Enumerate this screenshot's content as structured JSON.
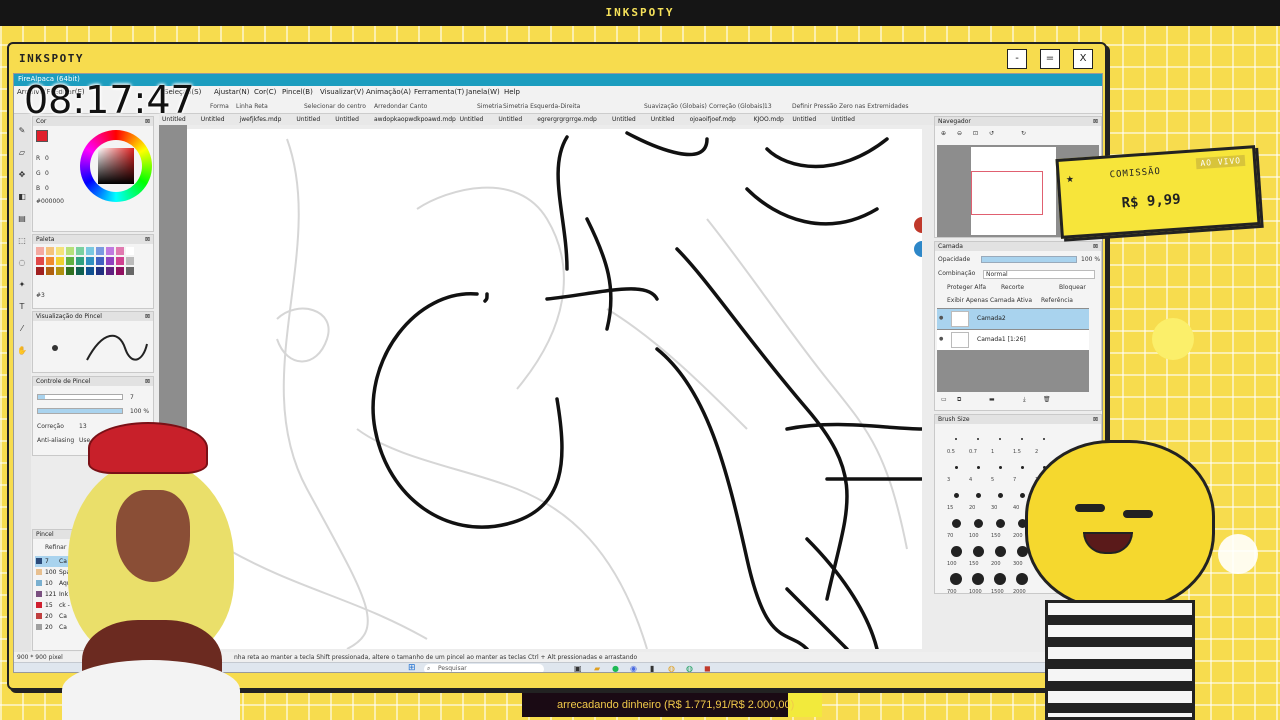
{
  "overlay": {
    "top_title": "INKSPOTY",
    "frame_title": "INKSPOTY",
    "frame_buttons": [
      "-",
      "=",
      "X"
    ],
    "clock": "08:17:47",
    "commission_label": "COMISSÃO",
    "commission_live": "AO VIVO",
    "commission_price": "R$  9,99",
    "goal_text": "arrecadando dinheiro (R$ 1.771,91/R$ 2.000,00)",
    "goal_progress": 0.886
  },
  "app": {
    "title": "FireAlpaca (64bit)",
    "menu": [
      "Arquivo(F)",
      "Editar(E)",
      "Seleção(S)",
      "Ajustar(N)",
      "Cor(C)",
      "Pincel(B)",
      "Visualizar(V)",
      "Animação(A)",
      "Ferramenta(T)",
      "Janela(W)",
      "Help"
    ],
    "toolopts": [
      "Forma",
      "Linha Reta",
      "Selecionar do centro",
      "Arredondar Canto",
      "Simetria",
      "Simetria Esquerda-Direita",
      "Suavização (Globais)",
      "Correção (Globais)",
      "13",
      "Definir Pressão Zero nas Extremidades"
    ],
    "doc_tabs": [
      "Untitled",
      "Untitled",
      "jwefjkfes.mdp",
      "Untitled",
      "Untitled",
      "awdopkaopwdkpoawd.mdp",
      "Untitled",
      "Untitled",
      "egrergrgrgrrge.mdp",
      "Untitled",
      "Untitled",
      "ojoaoifjoef.mdp",
      "KJOO.mdp",
      "Untitled",
      "Untitled"
    ],
    "status_left": "900 * 900 pixel",
    "status_hint": "nha reta ao manter a tecla Shift pressionada, altere o tamanho de um pincel ao manter as teclas Ctrl + Alt pressionadas e arrastando",
    "taskbar_search": "Pesquisar"
  },
  "panels": {
    "color": {
      "title": "Cor",
      "r": "R",
      "g": "G",
      "b": "B",
      "r_val": "0",
      "g_val": "0",
      "b_val": "0",
      "hex": "#000000",
      "current_color": "#e0202c"
    },
    "palette": {
      "title": "Paleta",
      "counter": "#3",
      "swatches": [
        "#f4a9a0",
        "#f4c27a",
        "#f4e27a",
        "#b6e07a",
        "#7ad0a0",
        "#7ac8e0",
        "#7a9ae0",
        "#c07ae0",
        "#e07ab0",
        "#ffffff",
        "#e04848",
        "#f08a30",
        "#f0d030",
        "#60b040",
        "#30a080",
        "#3090c0",
        "#4060c0",
        "#9040c0",
        "#d04090",
        "#bbbbbb",
        "#a02020",
        "#b06010",
        "#b09010",
        "#307020",
        "#106050",
        "#105090",
        "#203080",
        "#602080",
        "#901060",
        "#666666"
      ]
    },
    "brush_preview": {
      "title": "Visualização do Pincel"
    },
    "brush_control": {
      "title": "Controle de Pincel",
      "size": "7",
      "opacity": "100 %",
      "correction_label": "Correção",
      "correction": "13",
      "antialias": "Anti-aliasing",
      "use": "Use c"
    },
    "brush_list": {
      "title": "Pincel",
      "refine": "Refinar",
      "items": [
        {
          "size": "7",
          "name": "Ca",
          "color": "#2a4a7a"
        },
        {
          "size": "100",
          "name": "Spark (1 pc",
          "color": "#e8c090"
        },
        {
          "size": "10",
          "name": "Aquar",
          "color": "#7ab0d0"
        },
        {
          "size": "121",
          "name": "Ink Cl",
          "color": "#7a5080"
        },
        {
          "size": "15",
          "name": "ck - Larg",
          "color": "#d02030"
        },
        {
          "size": "20",
          "name": "Ca",
          "color": "#c04040"
        },
        {
          "size": "20",
          "name": "Ca",
          "color": "#a0a0a0"
        }
      ]
    },
    "navigator": {
      "title": "Navegador"
    },
    "layer": {
      "title": "Camada",
      "opacity_label": "Opacidade",
      "opacity": "100 %",
      "blend_label": "Combinação",
      "blend": "Normal",
      "protect_alpha": "Proteger Alfa",
      "clip": "Recorte",
      "lock": "Bloquear",
      "show_active": "Exibir Apenas Camada Ativa",
      "reference": "Referência",
      "layers": [
        {
          "name": "Camada2",
          "active": true
        },
        {
          "name": "Camada1 [1:26]",
          "active": false
        }
      ]
    },
    "brush_size": {
      "title": "Brush Size",
      "labels_row1": [
        "0.5",
        "0.7",
        "1",
        "1.5",
        "2"
      ],
      "labels_row2": [
        "3",
        "4",
        "5",
        "7",
        "10"
      ],
      "labels_row3": [
        "15",
        "20",
        "30",
        "40",
        "50"
      ],
      "labels_row4": [
        "70",
        "100",
        "150",
        "200"
      ],
      "labels_row5": [
        "100",
        "150",
        "200",
        "300"
      ],
      "labels_row6": [
        "700",
        "1000",
        "1500",
        "2000"
      ]
    }
  }
}
